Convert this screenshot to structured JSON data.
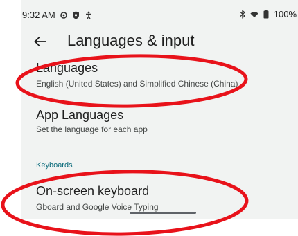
{
  "status_bar": {
    "time": "9:32 AM",
    "battery": "100%",
    "icons": [
      "settings-gear-icon",
      "shield-icon",
      "accessibility-icon",
      "bluetooth-icon",
      "wifi-icon",
      "battery-icon"
    ]
  },
  "app_bar": {
    "back_icon": "back-arrow-icon",
    "title": "Languages & input"
  },
  "items": [
    {
      "title": "Languages",
      "summary": "English (United States) and Simplified Chinese (China)"
    },
    {
      "title": "App Languages",
      "summary": "Set the language for each app"
    }
  ],
  "keyboards_section": {
    "header": "Keyboards",
    "items": [
      {
        "title": "On-screen keyboard",
        "summary": "Gboard and Google Voice Typing"
      }
    ]
  },
  "annotation_color": "#e8121a"
}
